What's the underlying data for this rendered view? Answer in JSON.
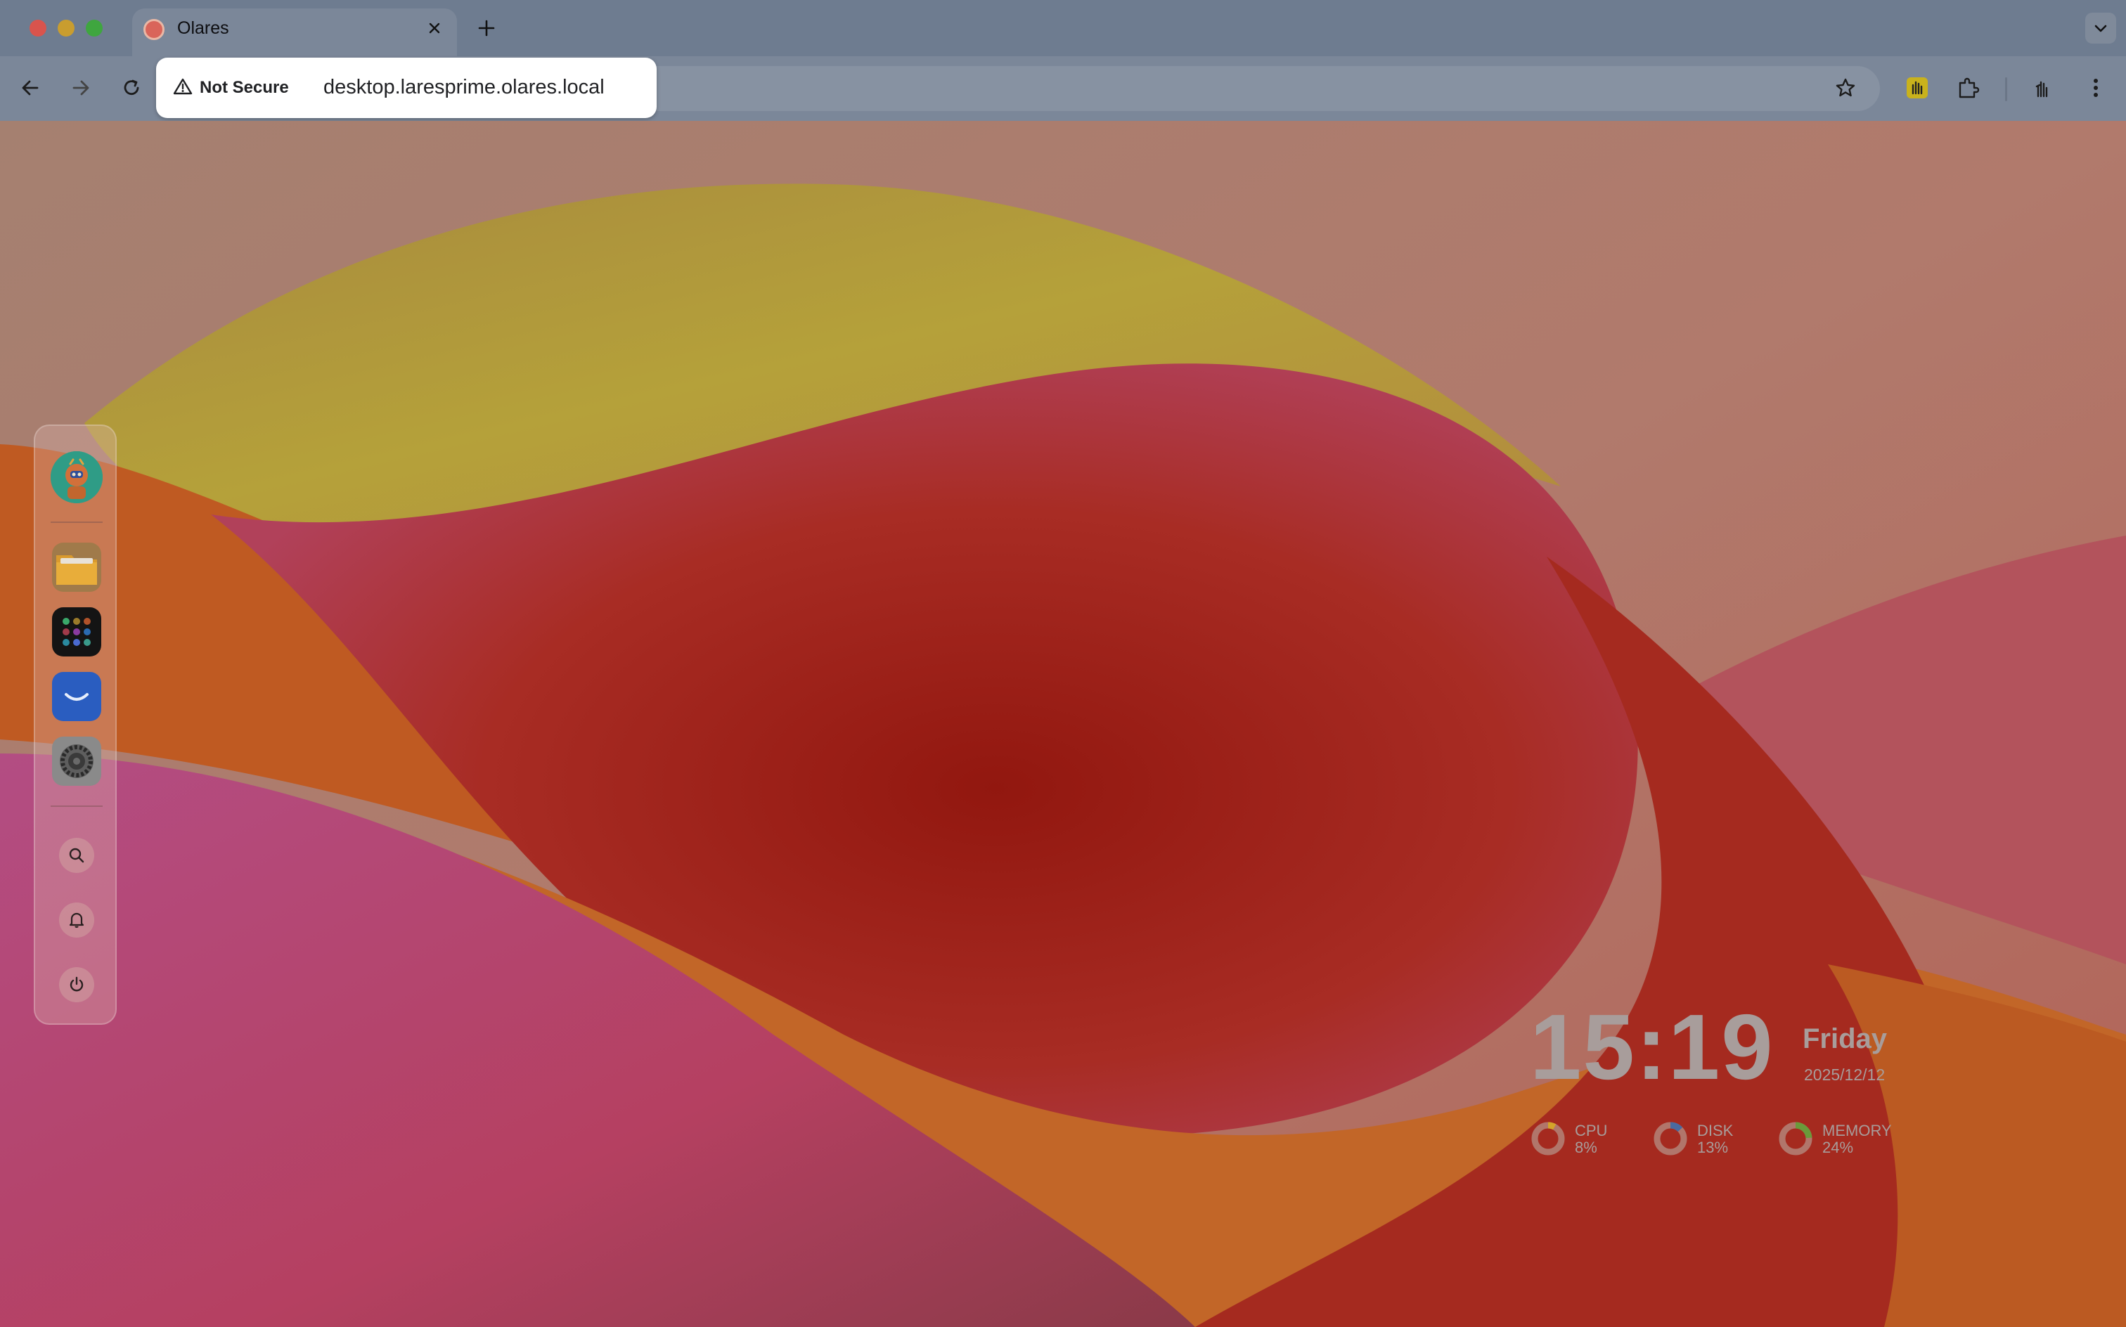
{
  "browser": {
    "tab_title": "Olares",
    "security_label": "Not Secure",
    "url": "desktop.laresprime.olares.local"
  },
  "dock": {
    "apps": [
      {
        "name": "Files",
        "icon": "folder-icon"
      },
      {
        "name": "Launchpad",
        "icon": "app-grid-icon"
      },
      {
        "name": "Market",
        "icon": "shopping-bag-icon"
      },
      {
        "name": "Settings",
        "icon": "gear-icon"
      }
    ],
    "actions": [
      "search-icon",
      "bell-icon",
      "power-icon"
    ]
  },
  "clock": {
    "time": "15:19",
    "day": "Friday",
    "date": "2025/12/12"
  },
  "stats": {
    "cpu": {
      "label": "CPU",
      "value": "8%",
      "percent": 8
    },
    "disk": {
      "label": "DISK",
      "value": "13%",
      "percent": 13
    },
    "memory": {
      "label": "MEMORY",
      "value": "24%",
      "percent": 24
    }
  },
  "colors": {
    "chrome_tabstrip": "#6e7c90",
    "chrome_toolbar": "#7b8799",
    "wallpaper_red": "#9c2418",
    "wallpaper_orange": "#c86a1c",
    "wallpaper_yellow": "#b5a13a",
    "wallpaper_pink": "#b5455f",
    "widget_text": "#a89d9b"
  }
}
